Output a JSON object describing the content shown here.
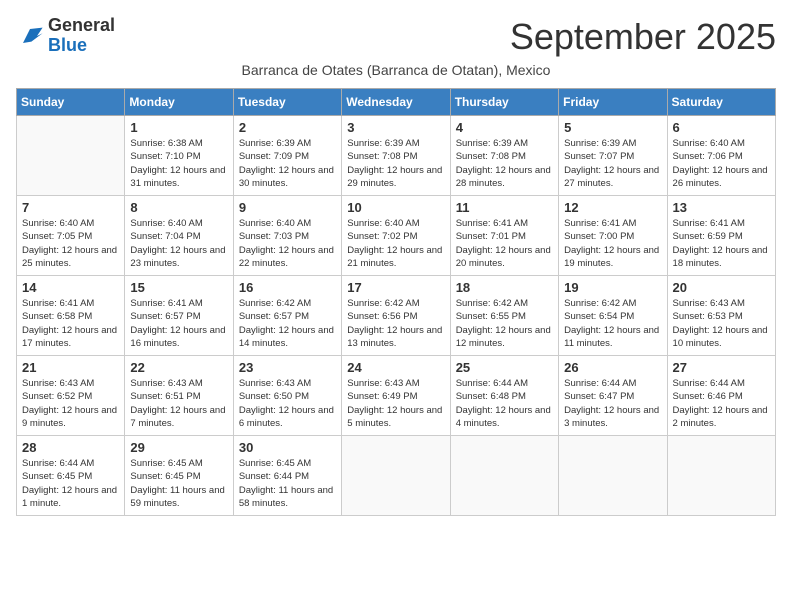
{
  "logo": {
    "text_general": "General",
    "text_blue": "Blue"
  },
  "header": {
    "month_title": "September 2025",
    "subtitle": "Barranca de Otates (Barranca de Otatan), Mexico"
  },
  "days_of_week": [
    "Sunday",
    "Monday",
    "Tuesday",
    "Wednesday",
    "Thursday",
    "Friday",
    "Saturday"
  ],
  "weeks": [
    [
      {
        "day": "",
        "info": ""
      },
      {
        "day": "1",
        "info": "Sunrise: 6:38 AM\nSunset: 7:10 PM\nDaylight: 12 hours and 31 minutes."
      },
      {
        "day": "2",
        "info": "Sunrise: 6:39 AM\nSunset: 7:09 PM\nDaylight: 12 hours and 30 minutes."
      },
      {
        "day": "3",
        "info": "Sunrise: 6:39 AM\nSunset: 7:08 PM\nDaylight: 12 hours and 29 minutes."
      },
      {
        "day": "4",
        "info": "Sunrise: 6:39 AM\nSunset: 7:08 PM\nDaylight: 12 hours and 28 minutes."
      },
      {
        "day": "5",
        "info": "Sunrise: 6:39 AM\nSunset: 7:07 PM\nDaylight: 12 hours and 27 minutes."
      },
      {
        "day": "6",
        "info": "Sunrise: 6:40 AM\nSunset: 7:06 PM\nDaylight: 12 hours and 26 minutes."
      }
    ],
    [
      {
        "day": "7",
        "info": "Sunrise: 6:40 AM\nSunset: 7:05 PM\nDaylight: 12 hours and 25 minutes."
      },
      {
        "day": "8",
        "info": "Sunrise: 6:40 AM\nSunset: 7:04 PM\nDaylight: 12 hours and 23 minutes."
      },
      {
        "day": "9",
        "info": "Sunrise: 6:40 AM\nSunset: 7:03 PM\nDaylight: 12 hours and 22 minutes."
      },
      {
        "day": "10",
        "info": "Sunrise: 6:40 AM\nSunset: 7:02 PM\nDaylight: 12 hours and 21 minutes."
      },
      {
        "day": "11",
        "info": "Sunrise: 6:41 AM\nSunset: 7:01 PM\nDaylight: 12 hours and 20 minutes."
      },
      {
        "day": "12",
        "info": "Sunrise: 6:41 AM\nSunset: 7:00 PM\nDaylight: 12 hours and 19 minutes."
      },
      {
        "day": "13",
        "info": "Sunrise: 6:41 AM\nSunset: 6:59 PM\nDaylight: 12 hours and 18 minutes."
      }
    ],
    [
      {
        "day": "14",
        "info": "Sunrise: 6:41 AM\nSunset: 6:58 PM\nDaylight: 12 hours and 17 minutes."
      },
      {
        "day": "15",
        "info": "Sunrise: 6:41 AM\nSunset: 6:57 PM\nDaylight: 12 hours and 16 minutes."
      },
      {
        "day": "16",
        "info": "Sunrise: 6:42 AM\nSunset: 6:57 PM\nDaylight: 12 hours and 14 minutes."
      },
      {
        "day": "17",
        "info": "Sunrise: 6:42 AM\nSunset: 6:56 PM\nDaylight: 12 hours and 13 minutes."
      },
      {
        "day": "18",
        "info": "Sunrise: 6:42 AM\nSunset: 6:55 PM\nDaylight: 12 hours and 12 minutes."
      },
      {
        "day": "19",
        "info": "Sunrise: 6:42 AM\nSunset: 6:54 PM\nDaylight: 12 hours and 11 minutes."
      },
      {
        "day": "20",
        "info": "Sunrise: 6:43 AM\nSunset: 6:53 PM\nDaylight: 12 hours and 10 minutes."
      }
    ],
    [
      {
        "day": "21",
        "info": "Sunrise: 6:43 AM\nSunset: 6:52 PM\nDaylight: 12 hours and 9 minutes."
      },
      {
        "day": "22",
        "info": "Sunrise: 6:43 AM\nSunset: 6:51 PM\nDaylight: 12 hours and 7 minutes."
      },
      {
        "day": "23",
        "info": "Sunrise: 6:43 AM\nSunset: 6:50 PM\nDaylight: 12 hours and 6 minutes."
      },
      {
        "day": "24",
        "info": "Sunrise: 6:43 AM\nSunset: 6:49 PM\nDaylight: 12 hours and 5 minutes."
      },
      {
        "day": "25",
        "info": "Sunrise: 6:44 AM\nSunset: 6:48 PM\nDaylight: 12 hours and 4 minutes."
      },
      {
        "day": "26",
        "info": "Sunrise: 6:44 AM\nSunset: 6:47 PM\nDaylight: 12 hours and 3 minutes."
      },
      {
        "day": "27",
        "info": "Sunrise: 6:44 AM\nSunset: 6:46 PM\nDaylight: 12 hours and 2 minutes."
      }
    ],
    [
      {
        "day": "28",
        "info": "Sunrise: 6:44 AM\nSunset: 6:45 PM\nDaylight: 12 hours and 1 minute."
      },
      {
        "day": "29",
        "info": "Sunrise: 6:45 AM\nSunset: 6:45 PM\nDaylight: 11 hours and 59 minutes."
      },
      {
        "day": "30",
        "info": "Sunrise: 6:45 AM\nSunset: 6:44 PM\nDaylight: 11 hours and 58 minutes."
      },
      {
        "day": "",
        "info": ""
      },
      {
        "day": "",
        "info": ""
      },
      {
        "day": "",
        "info": ""
      },
      {
        "day": "",
        "info": ""
      }
    ]
  ]
}
